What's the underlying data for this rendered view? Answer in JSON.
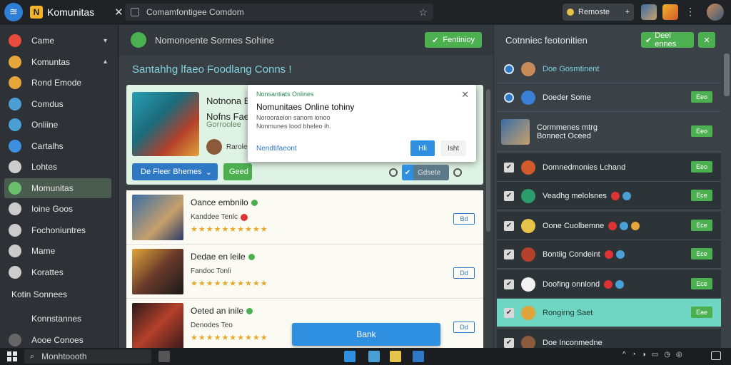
{
  "window": {
    "app_title": "Komunitas",
    "address": "Comamfontigee Comdom",
    "points_label": "Remoste"
  },
  "sidebar": {
    "items": [
      {
        "label": "Came",
        "caret": "▾",
        "color": "#e74c3c"
      },
      {
        "label": "Komuntas",
        "caret": "▴",
        "color": "#e6a73a"
      },
      {
        "label": "Rond Emode",
        "caret": "",
        "color": "#e6a73a"
      },
      {
        "label": "Comdus",
        "caret": "",
        "color": "#4a9fd4"
      },
      {
        "label": "Onliine",
        "caret": "",
        "color": "#4a9fd4"
      },
      {
        "label": "Cartalhs",
        "caret": "",
        "color": "#3d8fdf"
      },
      {
        "label": "Lohtes",
        "caret": "",
        "color": "#cccccc"
      },
      {
        "label": "Momunitas",
        "caret": "",
        "color": "#6bbf6b"
      },
      {
        "label": "Ioine Goos",
        "caret": "",
        "color": "#cccccc"
      },
      {
        "label": "Fochoniuntres",
        "caret": "",
        "color": "#cccccc"
      },
      {
        "label": "Mame",
        "caret": "",
        "color": "#cccccc"
      },
      {
        "label": "Korattes",
        "caret": "",
        "color": "#cccccc"
      }
    ],
    "section_label": "Kotin Sonnees",
    "bottom_items": [
      "Konnstannes",
      "Aooe Conoes"
    ]
  },
  "center": {
    "header_text": "Nomonoente Sormes Sohine",
    "header_button": "Fentinioy",
    "subtitle": "Santahhg lfaeo Foodlang Conns !",
    "featured": {
      "title_line1": "Notnona Eo",
      "title_line2": "Nofns Faed",
      "small_text": "Gorroolee",
      "mini_text": "Rarole",
      "primary_button": "De Fleer Bhemes",
      "secondary_button": "Geed"
    },
    "dialog": {
      "kicker": "Nonsantiats Onlines",
      "title": "Nomunitaes Online tohiny",
      "body_line1": "Norooraeion sanom ionoo",
      "body_line2": "Nonmunes lood bheleo ih.",
      "link": "Nendtifaeont",
      "ok": "Hli",
      "cancel": "Isht",
      "seg_label": "Gdsete"
    },
    "rows": [
      {
        "name": "Oance embnilo",
        "meta": "Kanddee Tenlc",
        "stars": "★★★★★★★★★★",
        "btn": "Bd"
      },
      {
        "name": "Dedae en leile",
        "meta": "Fandoc Tonli",
        "stars": "★★★★★★★★★★",
        "btn": "Dd"
      },
      {
        "name": "Oeted an inile",
        "meta": "Denodes Teo",
        "stars": "★★★★★★★★★★",
        "btn": "Dd"
      }
    ],
    "play_button": "Bank"
  },
  "right": {
    "header": "Cotnniec feotonitien",
    "button1": "Deel ennes",
    "rows": [
      {
        "label": "Doe Gosmtinent",
        "kind": "radio",
        "style": "",
        "btn": ""
      },
      {
        "label": "Doeder Some",
        "kind": "radio",
        "style": "",
        "btn": "Eeo"
      },
      {
        "label": "Cormmenes mtrg",
        "label2": "Bonnect Oceed",
        "kind": "avatar",
        "style": "",
        "btn": "Eeo"
      },
      {
        "label": "Domnedmonies Lchand",
        "kind": "check",
        "style": "dark",
        "btn": "Eeo"
      },
      {
        "label": "Veadhg melolsnes",
        "kind": "check",
        "style": "dark",
        "btn": "Ece"
      },
      {
        "label": "Oone Cuolbemne",
        "kind": "check",
        "style": "dark",
        "btn": "Ece"
      },
      {
        "label": "Bontiig Condeint",
        "kind": "check",
        "style": "dark",
        "btn": "Ece"
      },
      {
        "label": "Doofing onnlond",
        "kind": "check",
        "style": "dark",
        "btn": "Ece"
      },
      {
        "label": "Rongirng Saet",
        "kind": "check",
        "style": "hl",
        "btn": "Eae"
      },
      {
        "label": "Doe Inconmedne",
        "kind": "check",
        "style": "dark",
        "btn": ""
      }
    ]
  },
  "taskbar": {
    "search": "Monhtoooth"
  },
  "colors": {
    "accent_green": "#4caf50",
    "accent_blue": "#2f8fe0",
    "highlight_teal": "#6fd6c3"
  }
}
